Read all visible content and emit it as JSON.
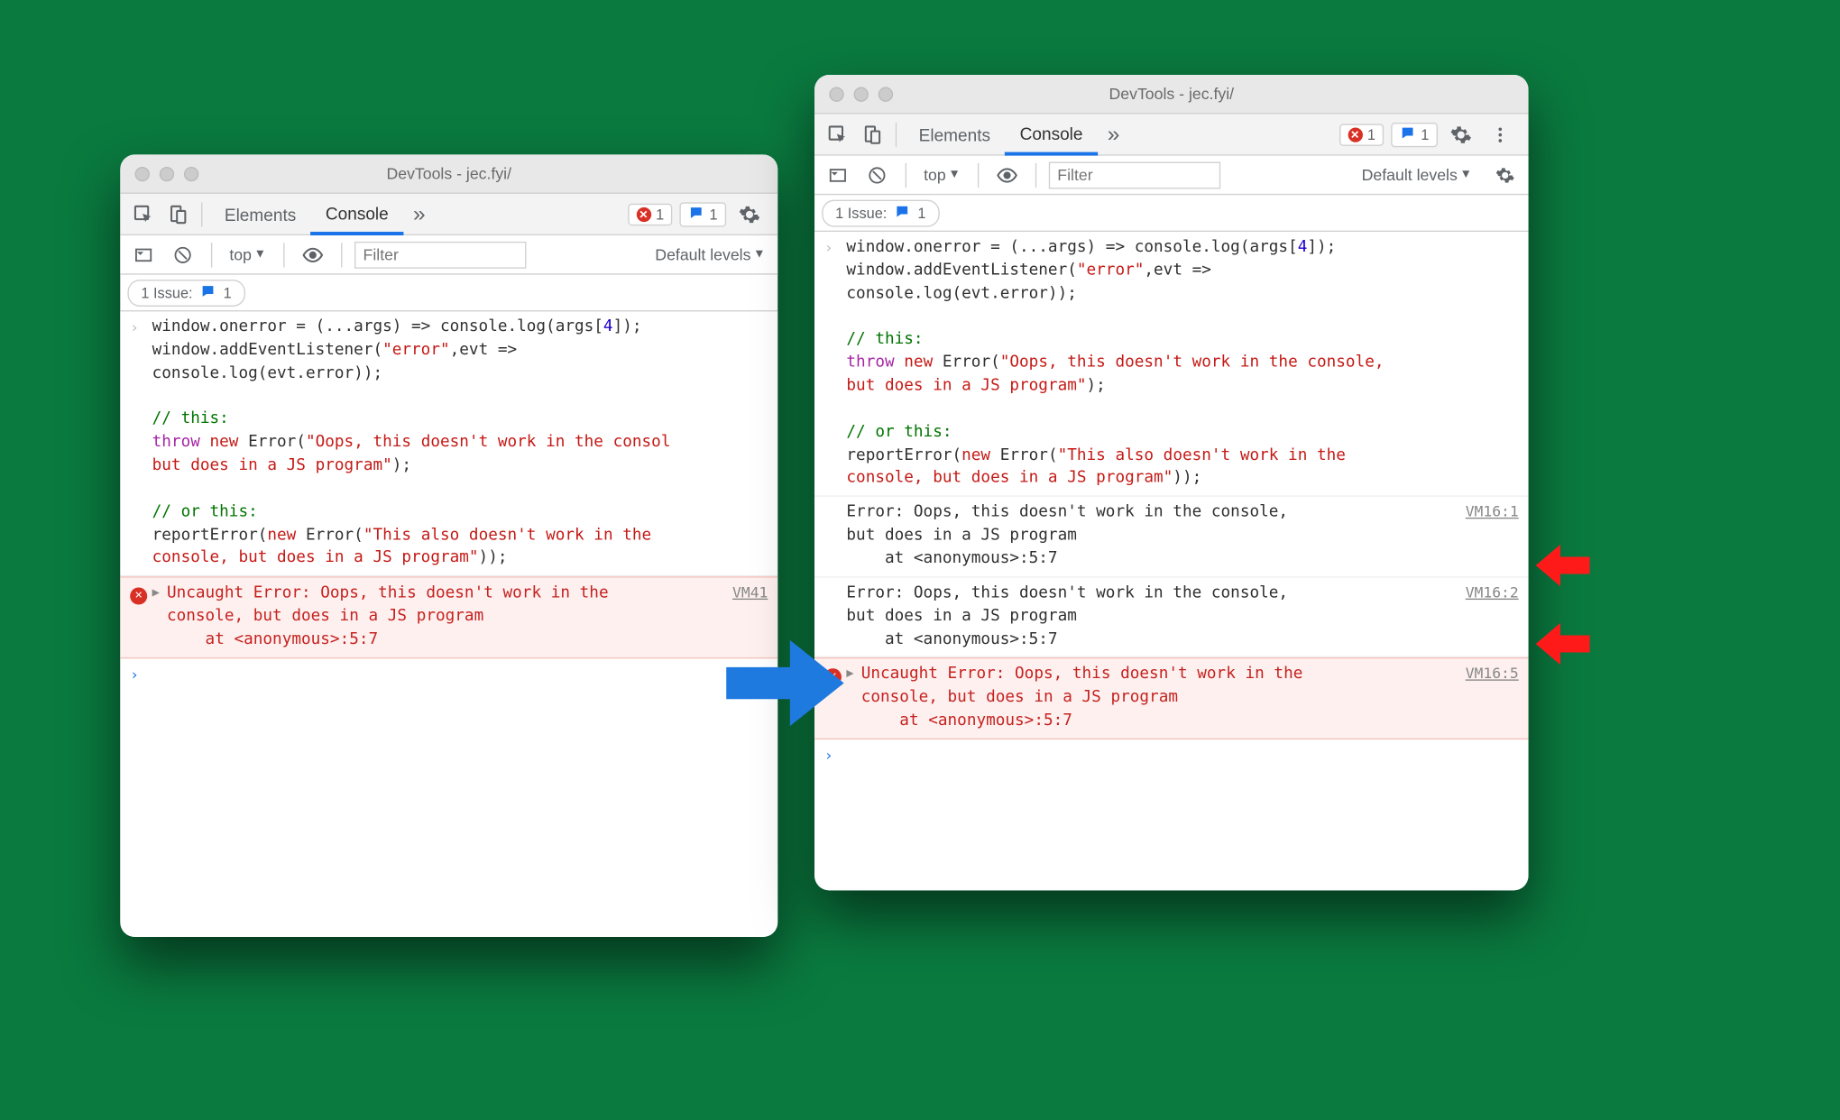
{
  "windowTitle": "DevTools - jec.fyi/",
  "tabs": {
    "elements": "Elements",
    "console": "Console",
    "more": "»"
  },
  "badges": {
    "errCount": "1",
    "msgCount": "1"
  },
  "subbar": {
    "context": "top",
    "filterPlaceholder": "Filter",
    "levels": "Default levels"
  },
  "issues": {
    "label": "1 Issue:",
    "count": "1"
  },
  "left": {
    "codeHtml": "window.onerror = (...args) => console.log(args[<span class=\"num\">4</span>]);\nwindow.addEventListener(<span class=\"str\">\"error\"</span>,evt =>\nconsole.log(evt.error));\n\n<span class=\"comment\">// this:</span>\n<span class=\"kw-purple\">throw</span> <span class=\"kw-red\">new</span> Error(<span class=\"str\">\"Oops, this doesn't work in the consol\nbut does in a JS program\"</span>);\n\n<span class=\"comment\">// or this:</span>\nreportError(<span class=\"kw-red\">new</span> Error(<span class=\"str\">\"This also doesn't work in the\nconsole, but does in a JS program\"</span>));",
    "err": {
      "text": "Uncaught Error: Oops, this doesn't work in the\nconsole, but does in a JS program\n    at <anonymous>:5:7",
      "link": "VM41"
    }
  },
  "right": {
    "codeHtml": "window.onerror = (...args) => console.log(args[<span class=\"num\">4</span>]);\nwindow.addEventListener(<span class=\"str\">\"error\"</span>,evt =>\nconsole.log(evt.error));\n\n<span class=\"comment\">// this:</span>\n<span class=\"kw-purple\">throw</span> <span class=\"kw-red\">new</span> Error(<span class=\"str\">\"Oops, this doesn't work in the console,\nbut does in a JS program\"</span>);\n\n<span class=\"comment\">// or this:</span>\nreportError(<span class=\"kw-red\">new</span> Error(<span class=\"str\">\"This also doesn't work in the\nconsole, but does in a JS program\"</span>));",
    "log1": {
      "text": "Error: Oops, this doesn't work in the console,\nbut does in a JS program\n    at <anonymous>:5:7",
      "link": "VM16:1"
    },
    "log2": {
      "text": "Error: Oops, this doesn't work in the console,\nbut does in a JS program\n    at <anonymous>:5:7",
      "link": "VM16:2"
    },
    "err": {
      "text": "Uncaught Error: Oops, this doesn't work in the\nconsole, but does in a JS program\n    at <anonymous>:5:7",
      "link": "VM16:5"
    }
  }
}
